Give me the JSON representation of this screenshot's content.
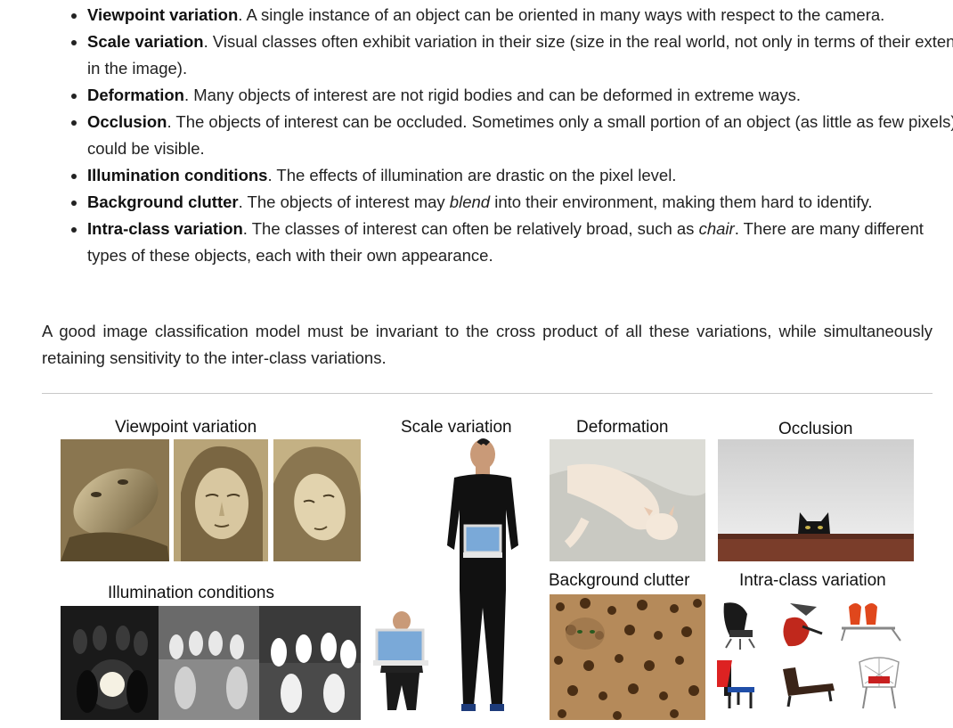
{
  "bullets": [
    {
      "term": "Viewpoint variation",
      "text": ". A single instance of an object can be oriented in many ways with respect to the camera."
    },
    {
      "term": "Scale variation",
      "text": ". Visual classes often exhibit variation in their size (size in the real world, not only in terms of their extent in the image)."
    },
    {
      "term": "Deformation",
      "text": ". Many objects of interest are not rigid bodies and can be deformed in extreme ways."
    },
    {
      "term": "Occlusion",
      "text": ". The objects of interest can be occluded. Sometimes only a small portion of an object (as little as few pixels) could be visible."
    },
    {
      "term": "Illumination conditions",
      "text": ". The effects of illumination are drastic on the pixel level."
    },
    {
      "term": "Background clutter",
      "text_before": ". The objects of interest may ",
      "em": "blend",
      "text_after": " into their environment, making them hard to identify."
    },
    {
      "term": "Intra-class variation",
      "text_before": ". The classes of interest can often be relatively broad, such as ",
      "em": "chair",
      "text_after": ". There are many different types of these objects, each with their own appearance."
    }
  ],
  "paragraph": "A good image classification model must be invariant to the cross product of all these variations, while simultaneously retaining sensitivity to the inter-class variations.",
  "figure": {
    "captions": {
      "viewpoint": "Viewpoint variation",
      "scale": "Scale variation",
      "deformation": "Deformation",
      "occlusion": "Occlusion",
      "illumination": "Illumination conditions",
      "clutter": "Background clutter",
      "intraclass": "Intra-class variation"
    }
  }
}
